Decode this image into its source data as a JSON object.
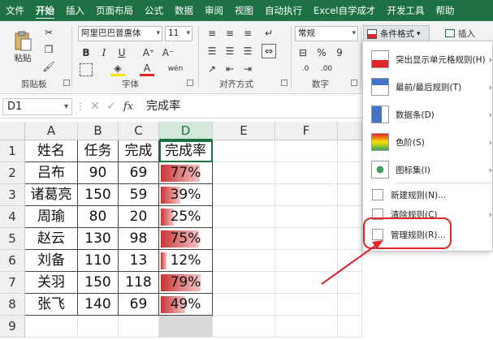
{
  "tabs": [
    "文件",
    "开始",
    "插入",
    "页面布局",
    "公式",
    "数据",
    "审阅",
    "视图",
    "自动执行",
    "Excel自学成才",
    "开发工具",
    "帮助"
  ],
  "active_tab": "开始",
  "ribbon": {
    "paste_label": "粘贴",
    "font_name": "阿里巴巴普惠体",
    "font_size": "11",
    "number_format": "常规",
    "groups": {
      "clipboard": "剪贴板",
      "font": "字体",
      "alignment": "对齐方式",
      "number": "数字"
    },
    "conditional_format": "条件格式",
    "insert": "插入",
    "number_buttons": [
      "%",
      "9"
    ]
  },
  "formula_bar": {
    "name_box": "D1",
    "content": "完成率"
  },
  "columns": [
    "A",
    "B",
    "C",
    "D",
    "E",
    "F"
  ],
  "rows": [
    "1",
    "2",
    "3",
    "4",
    "5",
    "6",
    "7",
    "8",
    "9"
  ],
  "table": {
    "header": [
      "姓名",
      "任务",
      "完成",
      "完成率"
    ],
    "data": [
      {
        "name": "吕布",
        "task": "90",
        "done": "69",
        "rate": "77%",
        "fill": 0.77
      },
      {
        "name": "诸葛亮",
        "task": "150",
        "done": "59",
        "rate": "39%",
        "fill": 0.39
      },
      {
        "name": "周瑜",
        "task": "80",
        "done": "20",
        "rate": "25%",
        "fill": 0.25
      },
      {
        "name": "赵云",
        "task": "130",
        "done": "98",
        "rate": "75%",
        "fill": 0.75
      },
      {
        "name": "刘备",
        "task": "110",
        "done": "13",
        "rate": "12%",
        "fill": 0.12
      },
      {
        "name": "关羽",
        "task": "150",
        "done": "118",
        "rate": "79%",
        "fill": 0.79
      },
      {
        "name": "张飞",
        "task": "140",
        "done": "69",
        "rate": "49%",
        "fill": 0.49
      }
    ]
  },
  "cf_menu": {
    "items": [
      {
        "label": "突出显示单元格规则(H)",
        "icon": "highlight-rules-icon",
        "sub": true
      },
      {
        "label": "最前/最后规则(T)",
        "icon": "top-bottom-rules-icon",
        "sub": true
      },
      {
        "label": "数据条(D)",
        "icon": "data-bars-icon",
        "sub": true
      },
      {
        "label": "色阶(S)",
        "icon": "color-scales-icon",
        "sub": true
      },
      {
        "label": "图标集(I)",
        "icon": "icon-sets-icon",
        "sub": true
      },
      {
        "label": "新建规则(N)...",
        "icon": "new-rule-icon",
        "sub": false
      },
      {
        "label": "清除规则(C)",
        "icon": "clear-rules-icon",
        "sub": true
      },
      {
        "label": "管理规则(R)...",
        "icon": "manage-rules-icon",
        "sub": false
      }
    ],
    "highlight_color": "#e0262b"
  },
  "colors": {
    "accent": "#1e7145",
    "databar": "#c83434"
  }
}
